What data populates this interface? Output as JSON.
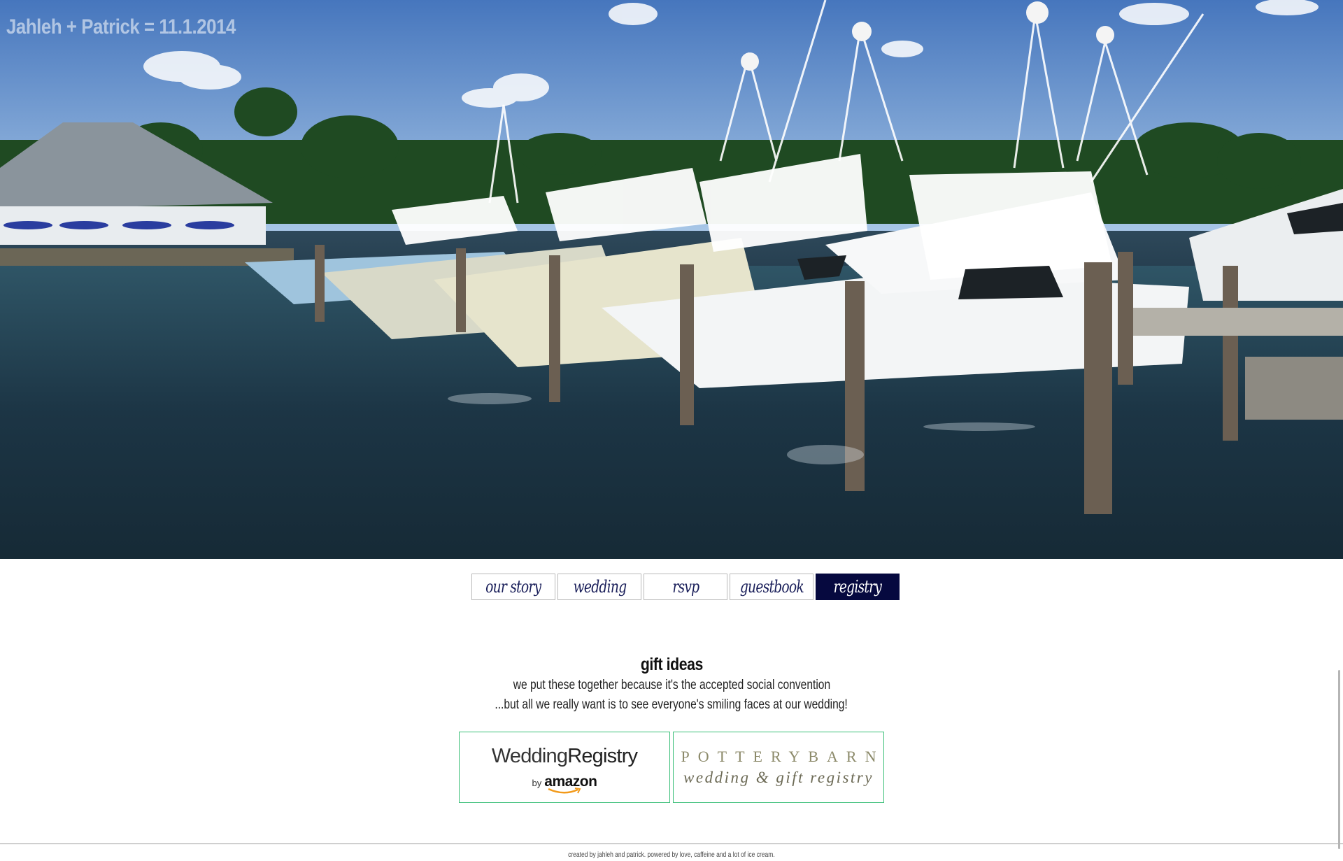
{
  "site": {
    "title": "Jahleh + Patrick = 11.1.2014"
  },
  "hero": {
    "image_description_icon": "marina-photo"
  },
  "nav": {
    "tabs": [
      {
        "label": "our story",
        "active": false
      },
      {
        "label": "wedding",
        "active": false
      },
      {
        "label": "rsvp",
        "active": false
      },
      {
        "label": "guestbook",
        "active": false
      },
      {
        "label": "registry",
        "active": true
      }
    ]
  },
  "registry": {
    "heading": "gift ideas",
    "line1": "we put these together because it's the accepted social convention",
    "line2": "...but all we really want is to see everyone's smiling faces at our wedding!",
    "amazon": {
      "title_part1": "Wedding",
      "title_part2": "Registry",
      "by": "by",
      "brand": "amazon"
    },
    "potterybarn": {
      "top": "POTTERYBARN",
      "bottom": "wedding & gift registry"
    }
  },
  "footer": {
    "text": "created by jahleh and patrick. powered by love, caffeine and a lot of ice cream."
  },
  "colors": {
    "nav_active_bg": "#06093f",
    "nav_text": "#1a1f5a",
    "registry_border": "#3bbf78"
  }
}
